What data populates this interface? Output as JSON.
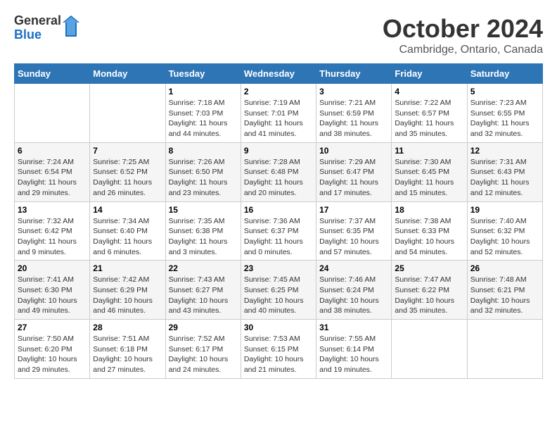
{
  "header": {
    "logo_general": "General",
    "logo_blue": "Blue",
    "month_year": "October 2024",
    "location": "Cambridge, Ontario, Canada"
  },
  "days_of_week": [
    "Sunday",
    "Monday",
    "Tuesday",
    "Wednesday",
    "Thursday",
    "Friday",
    "Saturday"
  ],
  "weeks": [
    [
      {
        "day": "",
        "sunrise": "",
        "sunset": "",
        "daylight": ""
      },
      {
        "day": "",
        "sunrise": "",
        "sunset": "",
        "daylight": ""
      },
      {
        "day": "1",
        "sunrise": "Sunrise: 7:18 AM",
        "sunset": "Sunset: 7:03 PM",
        "daylight": "Daylight: 11 hours and 44 minutes."
      },
      {
        "day": "2",
        "sunrise": "Sunrise: 7:19 AM",
        "sunset": "Sunset: 7:01 PM",
        "daylight": "Daylight: 11 hours and 41 minutes."
      },
      {
        "day": "3",
        "sunrise": "Sunrise: 7:21 AM",
        "sunset": "Sunset: 6:59 PM",
        "daylight": "Daylight: 11 hours and 38 minutes."
      },
      {
        "day": "4",
        "sunrise": "Sunrise: 7:22 AM",
        "sunset": "Sunset: 6:57 PM",
        "daylight": "Daylight: 11 hours and 35 minutes."
      },
      {
        "day": "5",
        "sunrise": "Sunrise: 7:23 AM",
        "sunset": "Sunset: 6:55 PM",
        "daylight": "Daylight: 11 hours and 32 minutes."
      }
    ],
    [
      {
        "day": "6",
        "sunrise": "Sunrise: 7:24 AM",
        "sunset": "Sunset: 6:54 PM",
        "daylight": "Daylight: 11 hours and 29 minutes."
      },
      {
        "day": "7",
        "sunrise": "Sunrise: 7:25 AM",
        "sunset": "Sunset: 6:52 PM",
        "daylight": "Daylight: 11 hours and 26 minutes."
      },
      {
        "day": "8",
        "sunrise": "Sunrise: 7:26 AM",
        "sunset": "Sunset: 6:50 PM",
        "daylight": "Daylight: 11 hours and 23 minutes."
      },
      {
        "day": "9",
        "sunrise": "Sunrise: 7:28 AM",
        "sunset": "Sunset: 6:48 PM",
        "daylight": "Daylight: 11 hours and 20 minutes."
      },
      {
        "day": "10",
        "sunrise": "Sunrise: 7:29 AM",
        "sunset": "Sunset: 6:47 PM",
        "daylight": "Daylight: 11 hours and 17 minutes."
      },
      {
        "day": "11",
        "sunrise": "Sunrise: 7:30 AM",
        "sunset": "Sunset: 6:45 PM",
        "daylight": "Daylight: 11 hours and 15 minutes."
      },
      {
        "day": "12",
        "sunrise": "Sunrise: 7:31 AM",
        "sunset": "Sunset: 6:43 PM",
        "daylight": "Daylight: 11 hours and 12 minutes."
      }
    ],
    [
      {
        "day": "13",
        "sunrise": "Sunrise: 7:32 AM",
        "sunset": "Sunset: 6:42 PM",
        "daylight": "Daylight: 11 hours and 9 minutes."
      },
      {
        "day": "14",
        "sunrise": "Sunrise: 7:34 AM",
        "sunset": "Sunset: 6:40 PM",
        "daylight": "Daylight: 11 hours and 6 minutes."
      },
      {
        "day": "15",
        "sunrise": "Sunrise: 7:35 AM",
        "sunset": "Sunset: 6:38 PM",
        "daylight": "Daylight: 11 hours and 3 minutes."
      },
      {
        "day": "16",
        "sunrise": "Sunrise: 7:36 AM",
        "sunset": "Sunset: 6:37 PM",
        "daylight": "Daylight: 11 hours and 0 minutes."
      },
      {
        "day": "17",
        "sunrise": "Sunrise: 7:37 AM",
        "sunset": "Sunset: 6:35 PM",
        "daylight": "Daylight: 10 hours and 57 minutes."
      },
      {
        "day": "18",
        "sunrise": "Sunrise: 7:38 AM",
        "sunset": "Sunset: 6:33 PM",
        "daylight": "Daylight: 10 hours and 54 minutes."
      },
      {
        "day": "19",
        "sunrise": "Sunrise: 7:40 AM",
        "sunset": "Sunset: 6:32 PM",
        "daylight": "Daylight: 10 hours and 52 minutes."
      }
    ],
    [
      {
        "day": "20",
        "sunrise": "Sunrise: 7:41 AM",
        "sunset": "Sunset: 6:30 PM",
        "daylight": "Daylight: 10 hours and 49 minutes."
      },
      {
        "day": "21",
        "sunrise": "Sunrise: 7:42 AM",
        "sunset": "Sunset: 6:29 PM",
        "daylight": "Daylight: 10 hours and 46 minutes."
      },
      {
        "day": "22",
        "sunrise": "Sunrise: 7:43 AM",
        "sunset": "Sunset: 6:27 PM",
        "daylight": "Daylight: 10 hours and 43 minutes."
      },
      {
        "day": "23",
        "sunrise": "Sunrise: 7:45 AM",
        "sunset": "Sunset: 6:25 PM",
        "daylight": "Daylight: 10 hours and 40 minutes."
      },
      {
        "day": "24",
        "sunrise": "Sunrise: 7:46 AM",
        "sunset": "Sunset: 6:24 PM",
        "daylight": "Daylight: 10 hours and 38 minutes."
      },
      {
        "day": "25",
        "sunrise": "Sunrise: 7:47 AM",
        "sunset": "Sunset: 6:22 PM",
        "daylight": "Daylight: 10 hours and 35 minutes."
      },
      {
        "day": "26",
        "sunrise": "Sunrise: 7:48 AM",
        "sunset": "Sunset: 6:21 PM",
        "daylight": "Daylight: 10 hours and 32 minutes."
      }
    ],
    [
      {
        "day": "27",
        "sunrise": "Sunrise: 7:50 AM",
        "sunset": "Sunset: 6:20 PM",
        "daylight": "Daylight: 10 hours and 29 minutes."
      },
      {
        "day": "28",
        "sunrise": "Sunrise: 7:51 AM",
        "sunset": "Sunset: 6:18 PM",
        "daylight": "Daylight: 10 hours and 27 minutes."
      },
      {
        "day": "29",
        "sunrise": "Sunrise: 7:52 AM",
        "sunset": "Sunset: 6:17 PM",
        "daylight": "Daylight: 10 hours and 24 minutes."
      },
      {
        "day": "30",
        "sunrise": "Sunrise: 7:53 AM",
        "sunset": "Sunset: 6:15 PM",
        "daylight": "Daylight: 10 hours and 21 minutes."
      },
      {
        "day": "31",
        "sunrise": "Sunrise: 7:55 AM",
        "sunset": "Sunset: 6:14 PM",
        "daylight": "Daylight: 10 hours and 19 minutes."
      },
      {
        "day": "",
        "sunrise": "",
        "sunset": "",
        "daylight": ""
      },
      {
        "day": "",
        "sunrise": "",
        "sunset": "",
        "daylight": ""
      }
    ]
  ]
}
